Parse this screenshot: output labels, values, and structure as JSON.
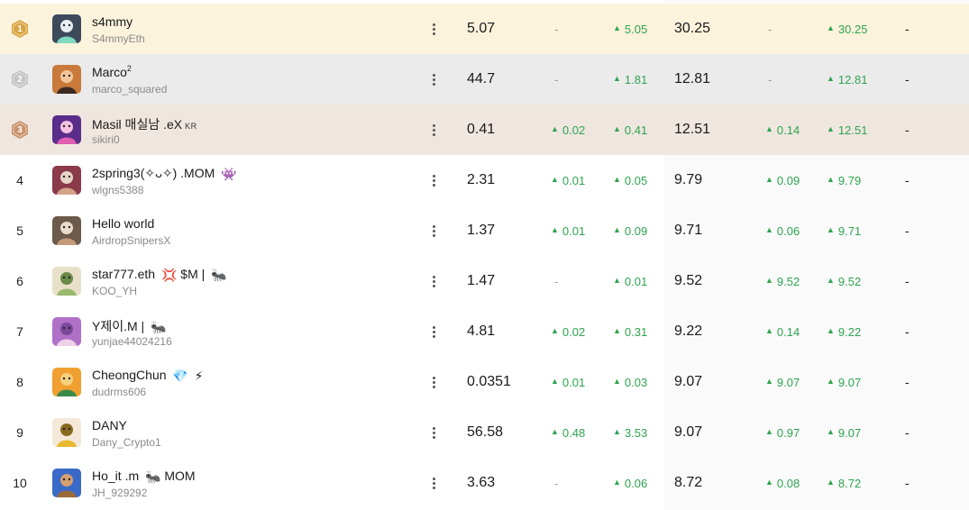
{
  "colors": {
    "up": "#2ea44f",
    "gold": "#d9a441",
    "silver": "#c4c4c4",
    "bronze": "#c9926a"
  },
  "rows": [
    {
      "rank": "1",
      "name": "s4mmy",
      "handle": "S4mmyEth",
      "v1": "5.07",
      "c1": "-",
      "c2": "5.05",
      "v2": "30.25",
      "c3": "-",
      "c4": "30.25",
      "last": "-"
    },
    {
      "rank": "2",
      "name": "Marco",
      "name_sup": "2",
      "handle": "marco_squared",
      "v1": "44.7",
      "c1": "-",
      "c2": "1.81",
      "v2": "12.81",
      "c3": "-",
      "c4": "12.81",
      "last": "-"
    },
    {
      "rank": "3",
      "name": "Masil 매실남 .eX",
      "name_tag": "KR",
      "handle": "sikiri0",
      "v1": "0.41",
      "c1": "0.02",
      "c2": "0.41",
      "v2": "12.51",
      "c3": "0.14",
      "c4": "12.51",
      "last": "-"
    },
    {
      "rank": "4",
      "name": "2spring3(✧ᴗ✧) .MOM",
      "name_emoji": "👾",
      "handle": "wlgns5388",
      "v1": "2.31",
      "c1": "0.01",
      "c2": "0.05",
      "v2": "9.79",
      "c3": "0.09",
      "c4": "9.79",
      "last": "-"
    },
    {
      "rank": "5",
      "name": "Hello world",
      "handle": "AirdropSnipersX",
      "v1": "1.37",
      "c1": "0.01",
      "c2": "0.09",
      "v2": "9.71",
      "c3": "0.06",
      "c4": "9.71",
      "last": "-"
    },
    {
      "rank": "6",
      "name": "star777.eth",
      "name_emoji": "💢",
      "name_suffix": "$M |",
      "name_emoji2": "🐜",
      "handle": "KOO_YH",
      "v1": "1.47",
      "c1": "-",
      "c2": "0.01",
      "v2": "9.52",
      "c3": "9.52",
      "c4": "9.52",
      "last": "-"
    },
    {
      "rank": "7",
      "name": "Y제이.M |",
      "name_emoji": "🐜",
      "handle": "yunjae44024216",
      "v1": "4.81",
      "c1": "0.02",
      "c2": "0.31",
      "v2": "9.22",
      "c3": "0.14",
      "c4": "9.22",
      "last": "-"
    },
    {
      "rank": "8",
      "name": "CheongChun",
      "name_emoji": "💎",
      "name_emoji2": "⚡",
      "handle": "dudrms606",
      "v1": "0.0351",
      "c1": "0.01",
      "c2": "0.03",
      "v2": "9.07",
      "c3": "9.07",
      "c4": "9.07",
      "last": "-"
    },
    {
      "rank": "9",
      "name": "DANY",
      "handle": "Dany_Crypto1",
      "v1": "56.58",
      "c1": "0.48",
      "c2": "3.53",
      "v2": "9.07",
      "c3": "0.97",
      "c4": "9.07",
      "last": "-"
    },
    {
      "rank": "10",
      "name": "Ho_it .m",
      "name_emoji": "🐜",
      "name_suffix": "MOM",
      "handle": "JH_929292",
      "v1": "3.63",
      "c1": "-",
      "c2": "0.06",
      "v2": "8.72",
      "c3": "0.08",
      "c4": "8.72",
      "last": "-"
    }
  ]
}
